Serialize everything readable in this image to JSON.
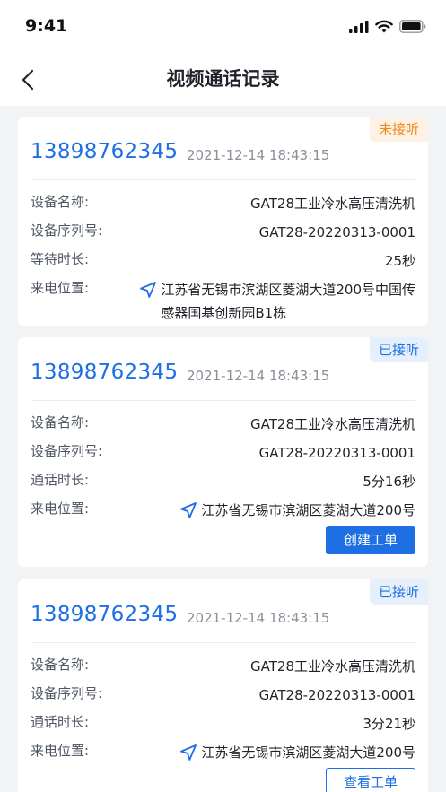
{
  "status_bar": {
    "time": "9:41"
  },
  "nav": {
    "title": "视频通话记录"
  },
  "labels": {
    "device_name": "设备名称:",
    "device_serial": "设备序列号:",
    "wait_duration": "等待时长:",
    "call_duration": "通话时长:",
    "call_location": "来电位置:"
  },
  "records": [
    {
      "phone": "13898762345",
      "datetime": "2021-12-14 18:43:15",
      "status": "未接听",
      "device_name": "GAT28工业冷水高压清洗机",
      "device_serial": "GAT28-20220313-0001",
      "duration": "25秒",
      "location_line1": "江苏省无锡市滨湖区菱湖大道200号中国传",
      "location_line2": "感器国基创新园B1栋"
    },
    {
      "phone": "13898762345",
      "datetime": "2021-12-14 18:43:15",
      "status": "已接听",
      "device_name": "GAT28工业冷水高压清洗机",
      "device_serial": "GAT28-20220313-0001",
      "duration": "5分16秒",
      "location": "江苏省无锡市滨湖区菱湖大道200号",
      "action": "创建工单"
    },
    {
      "phone": "13898762345",
      "datetime": "2021-12-14 18:43:15",
      "status": "已接听",
      "device_name": "GAT28工业冷水高压清洗机",
      "device_serial": "GAT28-20220313-0001",
      "duration": "3分21秒",
      "location": "江苏省无锡市滨湖区菱湖大道200号",
      "action": "查看工单"
    }
  ],
  "icons": {
    "back": "chevron-left-icon",
    "location": "navigation-arrow-icon",
    "signal": "cellular-signal-icon",
    "wifi": "wifi-icon",
    "battery": "battery-icon"
  },
  "colors": {
    "primary": "#1d6fe3",
    "missed_text": "#ef8a1a",
    "missed_bg": "#fdf1e3",
    "answered_bg": "#e6f0fd",
    "page_bg": "#f2f3f5"
  }
}
